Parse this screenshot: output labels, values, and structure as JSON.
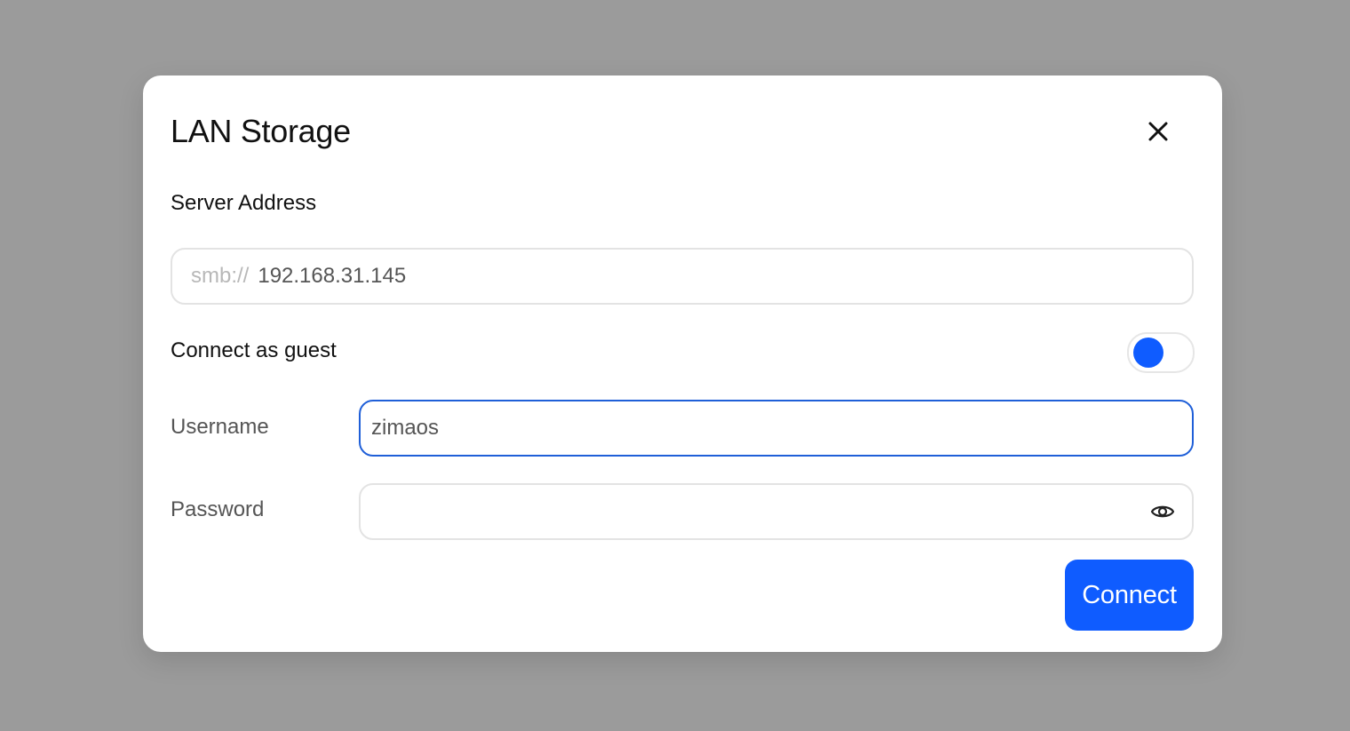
{
  "dialog": {
    "title": "LAN Storage",
    "close_icon": "close-icon"
  },
  "server": {
    "label": "Server Address",
    "prefix": "smb://",
    "value": "192.168.31.145"
  },
  "guest": {
    "label": "Connect as guest",
    "toggle_on": false,
    "accent_color": "#0f5cff"
  },
  "username": {
    "label": "Username",
    "value": "zimaos"
  },
  "password": {
    "label": "Password",
    "value": "",
    "toggle_icon": "eye-icon"
  },
  "actions": {
    "connect_label": "Connect"
  }
}
